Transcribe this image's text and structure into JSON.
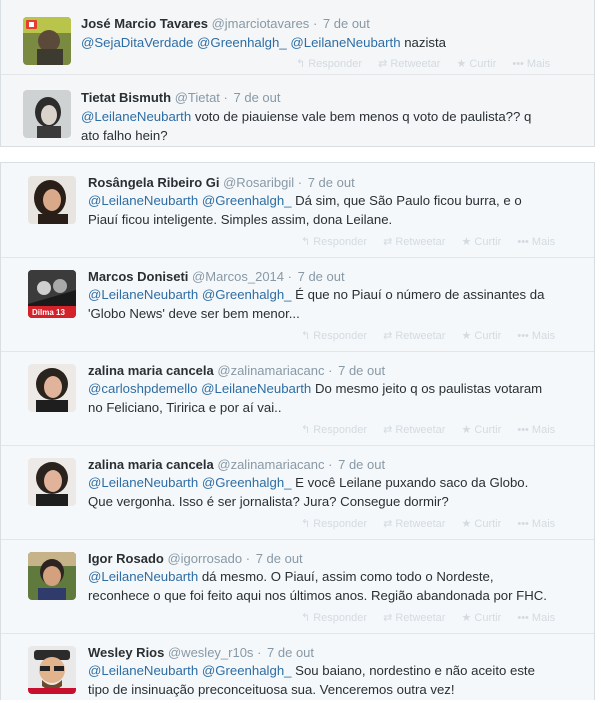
{
  "actions": {
    "reply": "Responder",
    "retweet": "Retweetar",
    "favorite": "Curtir",
    "more": "Mais"
  },
  "tweets": [
    {
      "name": "José Marcio Tavares",
      "handle": "@jmarciotavares",
      "time": "7 de out",
      "mentions": [
        "@SejaDitaVerdade",
        "@Greenhalgh_",
        "@LeilaneNeubarth"
      ],
      "text": "nazista",
      "text2": ""
    },
    {
      "name": "Tietat Bismuth",
      "handle": "@Tietat",
      "time": "7 de out",
      "mentions": [
        "@LeilaneNeubarth"
      ],
      "text": "voto de piauiense vale bem menos q voto de paulista?? q",
      "text2": "ato falho hein?"
    },
    {
      "name": "Rosângela Ribeiro Gi",
      "handle": "@Rosaribgil",
      "time": "7 de out",
      "mentions": [
        "@LeilaneNeubarth",
        "@Greenhalgh_"
      ],
      "text": "Dá sim, que São Paulo ficou burra, e o",
      "text2": "Piauí ficou inteligente. Simples assim, dona Leilane."
    },
    {
      "name": "Marcos Doniseti",
      "handle": "@Marcos_2014",
      "time": "7 de out",
      "mentions": [
        "@LeilaneNeubarth",
        "@Greenhalgh_"
      ],
      "text": "É que no Piauí o número de assinantes da",
      "text2": "'Globo News' deve ser bem menor..."
    },
    {
      "name": "zalina maria cancela",
      "handle": "@zalinamariacanc",
      "time": "7 de out",
      "mentions": [
        "@carloshpdemello",
        "@LeilaneNeubarth"
      ],
      "text": "Do mesmo jeito q os paulistas votaram",
      "text2": "no Feliciano, Tiririca e por aí vai.."
    },
    {
      "name": "zalina maria cancela",
      "handle": "@zalinamariacanc",
      "time": "7 de out",
      "mentions": [
        "@LeilaneNeubarth",
        "@Greenhalgh_"
      ],
      "text": "E você Leilane puxando saco da Globo.",
      "text2": "Que vergonha. Isso é ser jornalista? Jura? Consegue dormir?"
    },
    {
      "name": "Igor Rosado",
      "handle": "@igorrosado",
      "time": "7 de out",
      "mentions": [
        "@LeilaneNeubarth"
      ],
      "text": "dá mesmo. O Piauí, assim como todo o Nordeste,",
      "text2": "reconhece o que foi feito aqui nos últimos anos. Região abandonada por FHC."
    },
    {
      "name": "Wesley Rios",
      "handle": "@wesley_r10s",
      "time": "7 de out",
      "mentions": [
        "@LeilaneNeubarth",
        "@Greenhalgh_"
      ],
      "text": "Sou baiano, nordestino e não aceito este",
      "text2": "tipo de insinuação preconceituosa sua. Venceremos outra vez!"
    }
  ],
  "avatar_badge": "Dilma 13"
}
